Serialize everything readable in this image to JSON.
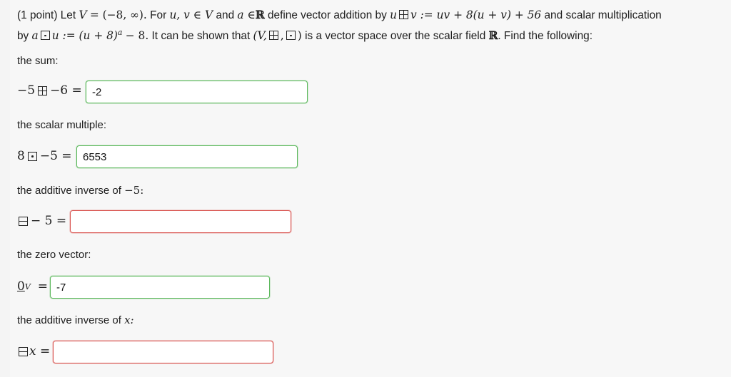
{
  "intro": {
    "points": "(1 point)",
    "t_let": "Let",
    "m_V": "V",
    "m_eq_set": "= (−8, ∞).",
    "t_for": "For",
    "m_uv": "u, v ∈ V",
    "t_and": "and",
    "m_a_in": "a ∈",
    "m_R1": "ℝ",
    "t_define_add": "define vector addition by",
    "m_u": "u",
    "m_v_def": "v := uv + 8(u + v) + 56",
    "t_and_scalar": "and scalar multiplication",
    "t_by": "by",
    "m_a": "a",
    "m_u_def": "u := (u + 8)",
    "m_exp_a": "a",
    "m_minus8": "− 8.",
    "t_shown": "It can be shown that",
    "m_triple_open": "(V,",
    "m_comma": ",",
    "m_triple_close": ")",
    "t_is_vs": "is a vector space over the scalar field",
    "m_R2": "ℝ",
    "t_find": ". Find the following:"
  },
  "q1": {
    "label": "the sum:",
    "left": "−5",
    "right": "−6 =",
    "value": "-2",
    "status": "correct"
  },
  "q2": {
    "label": "the scalar multiple:",
    "left": "8",
    "right": "−5 =",
    "value": "6553",
    "status": "correct"
  },
  "q3": {
    "label_text": "the additive inverse of",
    "label_math": "−5:",
    "right": "− 5 =",
    "value": "",
    "status": "incorrect"
  },
  "q4": {
    "label": "the zero vector:",
    "zero": "0",
    "sub": "V",
    "eq": "=",
    "value": "-7",
    "status": "correct"
  },
  "q5": {
    "label_text": "the additive inverse of",
    "label_math": "x:",
    "var": "x =",
    "value": "",
    "status": "incorrect"
  },
  "colors": {
    "correct_border": "#5cb85c",
    "incorrect_border": "#d9534f",
    "background": "#f7f7f7"
  }
}
